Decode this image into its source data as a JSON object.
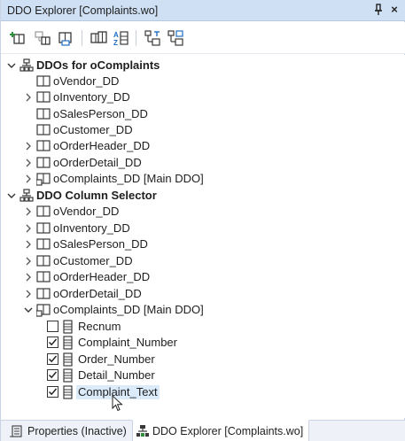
{
  "window": {
    "title": "DDO Explorer [Complaints.wo]",
    "pin_glyph": "⫪",
    "close_glyph": "×"
  },
  "toolbar": {
    "buttons": [
      {
        "name": "add-ddo-icon"
      },
      {
        "name": "add-child-ddo-icon"
      },
      {
        "name": "ddo-properties-icon"
      },
      {
        "name": "expand-all-icon"
      },
      {
        "name": "sort-icon"
      },
      {
        "name": "move-up-icon"
      },
      {
        "name": "move-down-icon"
      }
    ]
  },
  "tree": {
    "group1": {
      "label": "DDOs for oComplaints",
      "items": [
        {
          "label": "oVendor_DD",
          "expandable": false
        },
        {
          "label": "oInventory_DD",
          "expandable": true
        },
        {
          "label": "oSalesPerson_DD",
          "expandable": false
        },
        {
          "label": "oCustomer_DD",
          "expandable": false
        },
        {
          "label": "oOrderHeader_DD",
          "expandable": true
        },
        {
          "label": "oOrderDetail_DD",
          "expandable": true
        },
        {
          "label": "oComplaints_DD [Main DDO]",
          "expandable": true
        }
      ]
    },
    "group2": {
      "label": "DDO Column Selector",
      "items": [
        {
          "label": "oVendor_DD",
          "expandable": true
        },
        {
          "label": "oInventory_DD",
          "expandable": true
        },
        {
          "label": "oSalesPerson_DD",
          "expandable": true
        },
        {
          "label": "oCustomer_DD",
          "expandable": true
        },
        {
          "label": "oOrderHeader_DD",
          "expandable": true
        },
        {
          "label": "oOrderDetail_DD",
          "expandable": true
        },
        {
          "label": "oComplaints_DD [Main DDO]",
          "expandable": true,
          "expanded": true
        }
      ],
      "columns": [
        {
          "label": "Recnum",
          "checked": false
        },
        {
          "label": "Complaint_Number",
          "checked": true
        },
        {
          "label": "Order_Number",
          "checked": true
        },
        {
          "label": "Detail_Number",
          "checked": true
        },
        {
          "label": "Complaint_Text",
          "checked": true,
          "selected": true
        }
      ]
    }
  },
  "tabs": {
    "properties": "Properties (Inactive)",
    "explorer": "DDO Explorer [Complaints.wo]"
  },
  "colors": {
    "titlebar": "#cfe0f4",
    "selection": "#dcebfa",
    "icon_dark": "#3a3a3a",
    "icon_green": "#2f8f3a",
    "icon_blue": "#1f6fc5"
  }
}
